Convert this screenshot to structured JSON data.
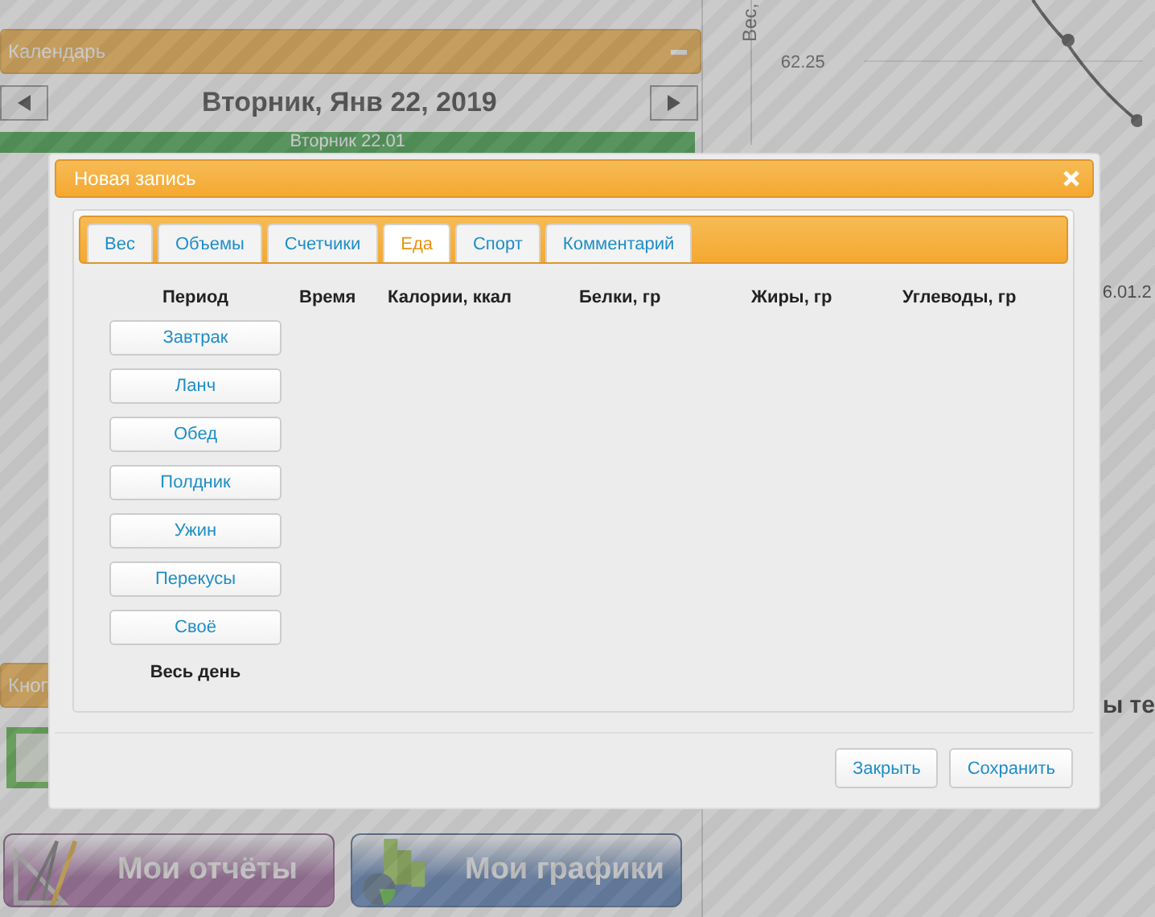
{
  "background": {
    "calendar": {
      "title": "Календарь",
      "date": "Вторник, Янв 22, 2019",
      "day_bar": "Вторник 22.01"
    },
    "chart": {
      "ylabel": "Вес,",
      "ytick": "62.25",
      "xtick": "6.01.2"
    },
    "heading_fragment": "ы те",
    "buttons_panel": {
      "title": "Кноп"
    },
    "big_buttons": [
      {
        "label": "Мои отчёты",
        "kind": "reports"
      },
      {
        "label": "Мои графики",
        "kind": "charts"
      }
    ]
  },
  "modal": {
    "title": "Новая запись",
    "tabs": [
      {
        "label": "Вес",
        "selected": false
      },
      {
        "label": "Объемы",
        "selected": false
      },
      {
        "label": "Счетчики",
        "selected": false
      },
      {
        "label": "Еда",
        "selected": true
      },
      {
        "label": "Спорт",
        "selected": false
      },
      {
        "label": "Комментарий",
        "selected": false
      }
    ],
    "columns": [
      "Период",
      "Время",
      "Калории, ккал",
      "Белки, гр",
      "Жиры, гр",
      "Углеводы, гр"
    ],
    "periods": [
      "Завтрак",
      "Ланч",
      "Обед",
      "Полдник",
      "Ужин",
      "Перекусы",
      "Своё"
    ],
    "total_label": "Весь день",
    "buttons": [
      "Закрыть",
      "Сохранить"
    ]
  }
}
